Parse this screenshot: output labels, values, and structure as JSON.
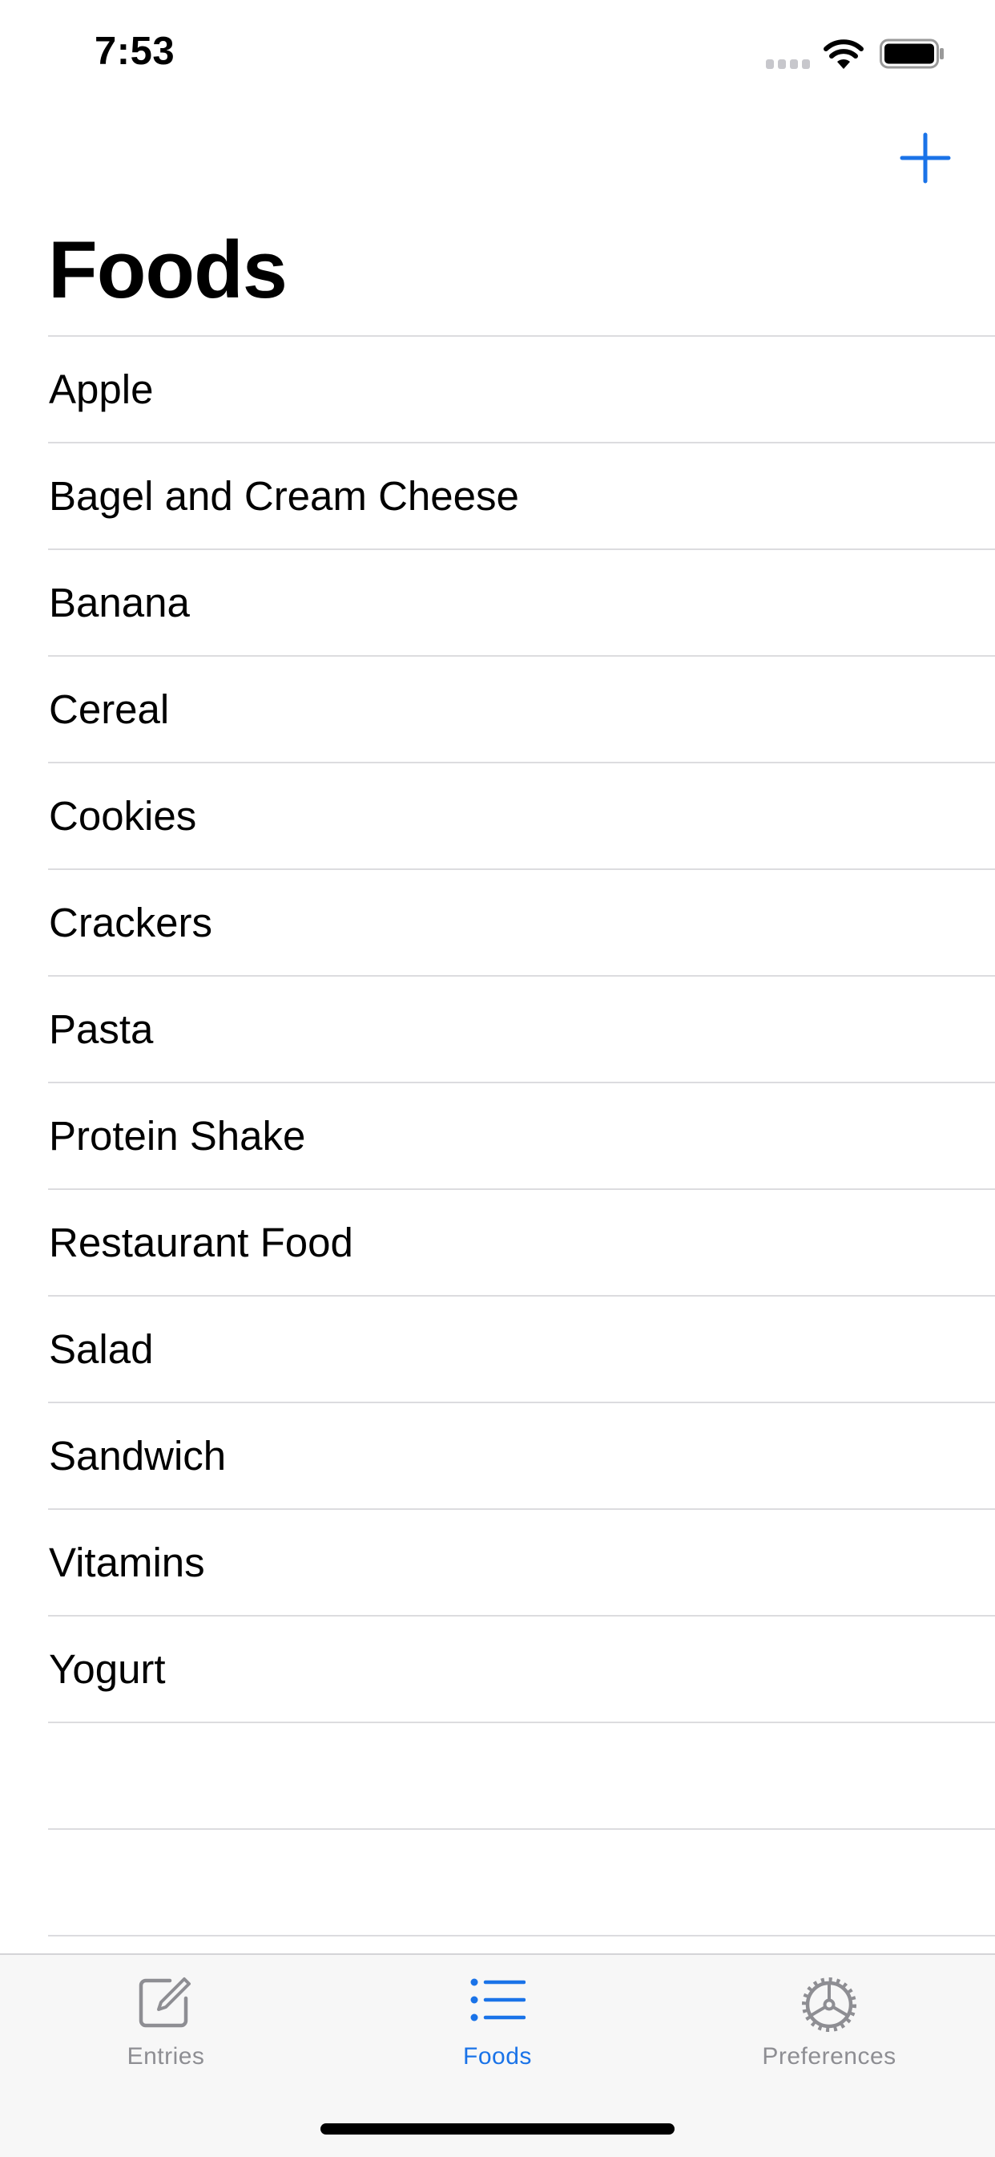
{
  "status_bar": {
    "time": "7:53",
    "signal_icon": "cellular-signal-icon",
    "wifi_icon": "wifi-icon",
    "battery_icon": "battery-icon"
  },
  "nav": {
    "add_icon": "plus-icon",
    "title": "Foods"
  },
  "colors": {
    "accent": "#1a73e8",
    "inactive": "#8e8e93",
    "separator": "#dcdcdf",
    "tab_bar_bg": "#f7f7f7"
  },
  "foods": [
    {
      "label": "Apple"
    },
    {
      "label": "Bagel and Cream Cheese"
    },
    {
      "label": "Banana"
    },
    {
      "label": "Cereal"
    },
    {
      "label": "Cookies"
    },
    {
      "label": "Crackers"
    },
    {
      "label": "Pasta"
    },
    {
      "label": "Protein Shake"
    },
    {
      "label": "Restaurant Food"
    },
    {
      "label": "Salad"
    },
    {
      "label": "Sandwich"
    },
    {
      "label": "Vitamins"
    },
    {
      "label": "Yogurt"
    }
  ],
  "tabs": [
    {
      "label": "Entries",
      "icon": "compose-icon",
      "selected": false
    },
    {
      "label": "Foods",
      "icon": "list-icon",
      "selected": true
    },
    {
      "label": "Preferences",
      "icon": "gear-icon",
      "selected": false
    }
  ]
}
